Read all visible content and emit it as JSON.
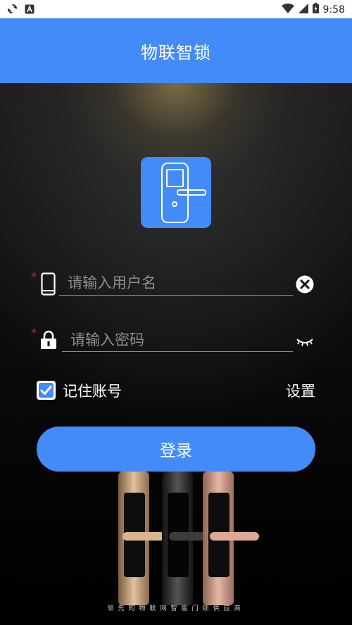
{
  "status_bar": {
    "time": "9:58",
    "icons": [
      "sync-icon",
      "a-notification-icon",
      "wifi-icon",
      "signal-icon",
      "battery-icon"
    ]
  },
  "app_bar": {
    "title": "物联智锁"
  },
  "login": {
    "username": {
      "placeholder": "请输入用户名",
      "required_mark": "*",
      "icon": "phone-icon",
      "action_icon": "clear-icon"
    },
    "password": {
      "placeholder": "请输入密码",
      "required_mark": "*",
      "icon": "lock-icon",
      "action_icon": "eye-closed-icon"
    },
    "remember": {
      "label": "记住账号",
      "checked": true
    },
    "settings_label": "设置",
    "submit_label": "登录"
  },
  "banner": {
    "tagline": "领先的物联网智能门锁供应商"
  },
  "colors": {
    "primary": "#428BF9",
    "required": "#E21C1C"
  }
}
